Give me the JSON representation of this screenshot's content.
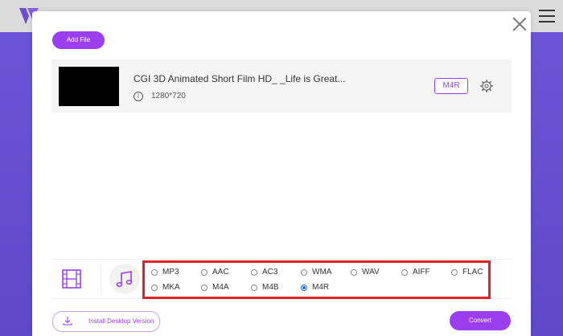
{
  "modal": {
    "add_file_label": "Add File"
  },
  "file": {
    "title": "CGI 3D Animated Short Film HD_ _Life is Great...",
    "resolution": "1280*720",
    "output_format": "M4R",
    "info_icon_glyph": "i"
  },
  "audio_formats": {
    "row1": [
      "MP3",
      "AAC",
      "AC3",
      "WMA",
      "WAV",
      "AIFF",
      "FLAC"
    ],
    "row2": [
      "MKA",
      "M4A",
      "M4B",
      "M4R"
    ],
    "selected": "M4R"
  },
  "footer": {
    "install_label": "Install Desktop Version",
    "convert_label": "Convert"
  },
  "colors": {
    "accent": "#9b3ef0",
    "highlight_border": "#e0202a",
    "radio_selected": "#2a6be0"
  }
}
